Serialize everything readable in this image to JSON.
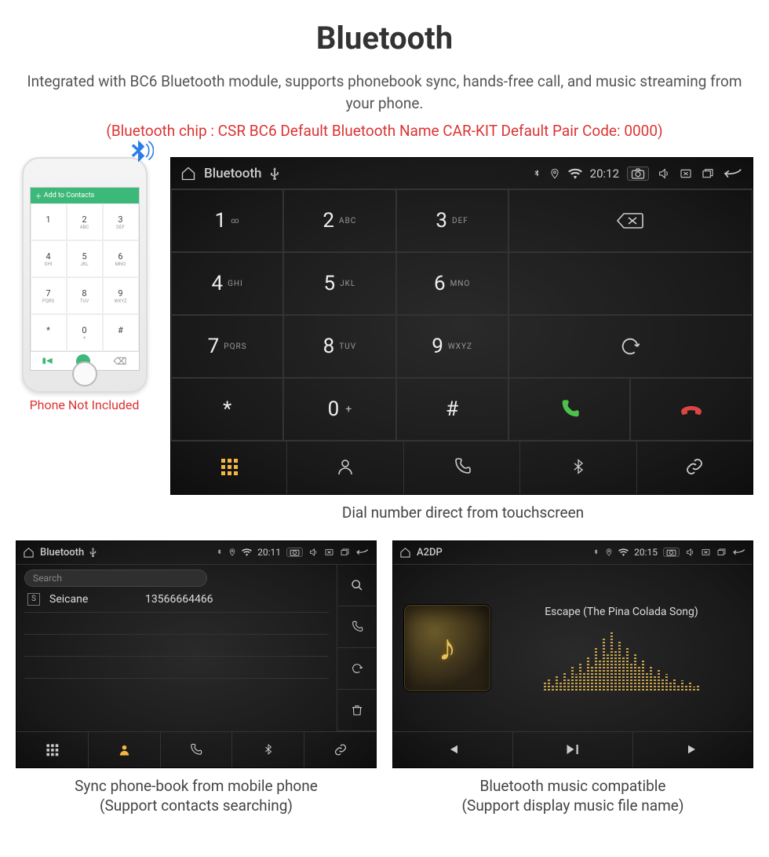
{
  "heading": "Bluetooth",
  "subline": "Integrated with BC6 Bluetooth module, supports phonebook sync, hands-free call, and music streaming from your phone.",
  "redline": "(Bluetooth chip : CSR BC6     Default Bluetooth Name CAR-KIT     Default Pair Code: 0000)",
  "phone_mock": {
    "caption": "Phone Not Included",
    "top": "Add to Contacts",
    "keys": [
      {
        "n": "1",
        "s": ""
      },
      {
        "n": "2",
        "s": "ABC"
      },
      {
        "n": "3",
        "s": "DEF"
      },
      {
        "n": "4",
        "s": "GHI"
      },
      {
        "n": "5",
        "s": "JKL"
      },
      {
        "n": "6",
        "s": "MNO"
      },
      {
        "n": "7",
        "s": "PQRS"
      },
      {
        "n": "8",
        "s": "TUV"
      },
      {
        "n": "9",
        "s": "WXYZ"
      },
      {
        "n": "*",
        "s": ""
      },
      {
        "n": "0",
        "s": "+"
      },
      {
        "n": "#",
        "s": ""
      }
    ]
  },
  "dialer": {
    "top_title": "Bluetooth",
    "time": "20:12",
    "caption": "Dial number direct from touchscreen",
    "keys": [
      {
        "n": "1",
        "s": "∞"
      },
      {
        "n": "2",
        "s": "ABC"
      },
      {
        "n": "3",
        "s": "DEF"
      },
      {
        "n": "4",
        "s": "GHI"
      },
      {
        "n": "5",
        "s": "JKL"
      },
      {
        "n": "6",
        "s": "MNO"
      },
      {
        "n": "7",
        "s": "PQRS"
      },
      {
        "n": "8",
        "s": "TUV"
      },
      {
        "n": "9",
        "s": "WXYZ"
      },
      {
        "n": "*",
        "s": ""
      },
      {
        "n": "0",
        "s": "",
        "sup": "+"
      },
      {
        "n": "#",
        "s": ""
      }
    ]
  },
  "phonebook": {
    "top_title": "Bluetooth",
    "time": "20:11",
    "search_placeholder": "Search",
    "contact_letter": "S",
    "contact_name": "Seicane",
    "contact_number": "13566664466",
    "caption_l1": "Sync phone-book from mobile phone",
    "caption_l2": "(Support contacts searching)"
  },
  "a2dp": {
    "top_title": "A2DP",
    "time": "20:15",
    "song": "Escape (The Pina Colada Song)",
    "caption_l1": "Bluetooth music compatible",
    "caption_l2": "(Support display music file name)"
  }
}
